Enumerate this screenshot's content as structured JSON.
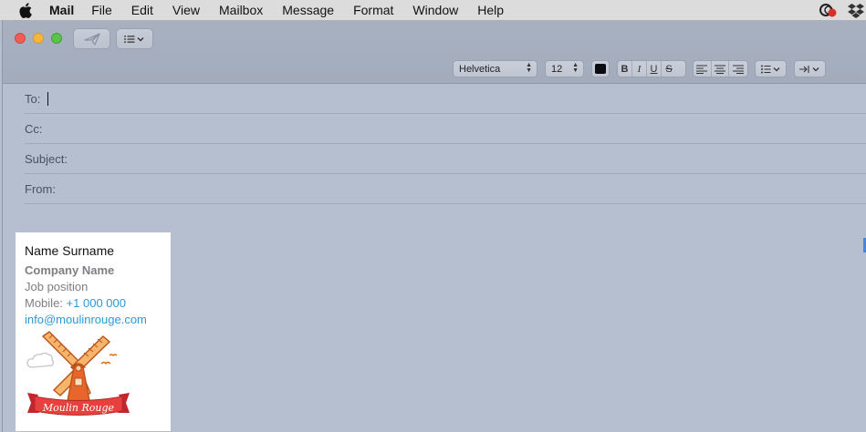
{
  "menubar": {
    "app_name": "Mail",
    "items": [
      "File",
      "Edit",
      "View",
      "Mailbox",
      "Message",
      "Format",
      "Window",
      "Help"
    ]
  },
  "format_bar": {
    "font": "Helvetica",
    "size": "12",
    "color": "#111111",
    "bold": "B",
    "italic": "I",
    "underline": "U",
    "strike": "S"
  },
  "fields": {
    "to_label": "To:",
    "to_value": "",
    "cc_label": "Cc:",
    "subject_label": "Subject:",
    "from_label": "From:"
  },
  "signature": {
    "name": "Name Surname",
    "company": "Company Name",
    "position": "Job position",
    "mobile_label": "Mobile:",
    "mobile_number": "+1 000 000",
    "email": "info@moulinrouge.com",
    "logo_text": "Moulin Rouge"
  }
}
